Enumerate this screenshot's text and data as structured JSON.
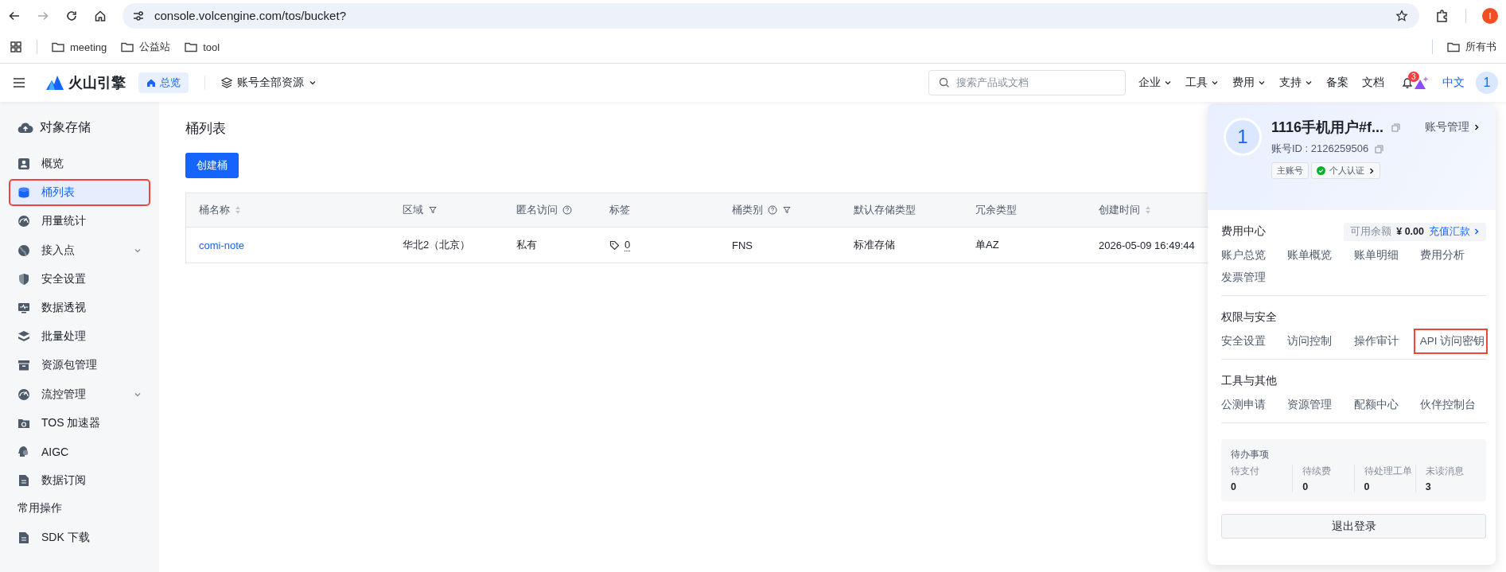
{
  "browser": {
    "url": "console.volcengine.com/tos/bucket?",
    "profile_initial": "I",
    "bookmarks": [
      {
        "label": "meeting"
      },
      {
        "label": "公益站"
      },
      {
        "label": "tool"
      }
    ],
    "bookmarks_right": "所有书"
  },
  "header": {
    "logo": "火山引擎",
    "home": "总览",
    "scope": "账号全部资源",
    "search_placeholder": "搜索产品或文档",
    "menus": [
      {
        "label": "企业",
        "has_menu": true
      },
      {
        "label": "工具",
        "has_menu": true
      },
      {
        "label": "费用",
        "has_menu": true
      },
      {
        "label": "支持",
        "has_menu": true
      },
      {
        "label": "备案",
        "has_menu": false
      },
      {
        "label": "文档",
        "has_menu": false
      }
    ],
    "notification_count": "3",
    "language": {
      "label": "中文",
      "selected": true
    },
    "avatar": "1"
  },
  "sidebar": {
    "title": "对象存储",
    "items": [
      {
        "label": "概览",
        "selected": false,
        "has_submenu": false,
        "highlighted": false
      },
      {
        "label": "桶列表",
        "selected": true,
        "has_submenu": false,
        "highlighted": true
      },
      {
        "label": "用量统计",
        "selected": false,
        "has_submenu": false,
        "highlighted": false
      },
      {
        "label": "接入点",
        "selected": false,
        "has_submenu": true,
        "highlighted": false
      },
      {
        "label": "安全设置",
        "selected": false,
        "has_submenu": false,
        "highlighted": false
      },
      {
        "label": "数据透视",
        "selected": false,
        "has_submenu": false,
        "highlighted": false
      },
      {
        "label": "批量处理",
        "selected": false,
        "has_submenu": false,
        "highlighted": false
      },
      {
        "label": "资源包管理",
        "selected": false,
        "has_submenu": false,
        "highlighted": false
      },
      {
        "label": "流控管理",
        "selected": false,
        "has_submenu": true,
        "highlighted": false
      },
      {
        "label": "TOS 加速器",
        "selected": false,
        "has_submenu": false,
        "highlighted": false
      },
      {
        "label": "AIGC",
        "selected": false,
        "has_submenu": false,
        "highlighted": false
      },
      {
        "label": "数据订阅",
        "selected": false,
        "has_submenu": false,
        "highlighted": false
      }
    ],
    "section": "常用操作",
    "ops": [
      {
        "label": "SDK 下载"
      }
    ]
  },
  "page": {
    "title": "桶列表",
    "create_button": "创建桶",
    "table": {
      "columns": [
        {
          "label": "桶名称",
          "kind": "link",
          "sortable": true,
          "help": false,
          "filter": false
        },
        {
          "label": "区域",
          "kind": "text",
          "sortable": false,
          "help": false,
          "filter": true
        },
        {
          "label": "匿名访问",
          "kind": "text",
          "sortable": false,
          "help": true,
          "filter": false
        },
        {
          "label": "标签",
          "kind": "tag",
          "sortable": false,
          "help": false,
          "filter": false
        },
        {
          "label": "桶类别",
          "kind": "text",
          "sortable": false,
          "help": true,
          "filter": true
        },
        {
          "label": "默认存储类型",
          "kind": "text",
          "sortable": false,
          "help": false,
          "filter": false
        },
        {
          "label": "冗余类型",
          "kind": "text",
          "sortable": false,
          "help": false,
          "filter": false
        },
        {
          "label": "创建时间",
          "kind": "text",
          "sortable": true,
          "help": false,
          "filter": false
        }
      ],
      "rows": [
        [
          "comi-note",
          "华北2（北京）",
          "私有",
          "0",
          "FNS",
          "标准存储",
          "单AZ",
          "2026-05-09 16:49:44"
        ]
      ]
    }
  },
  "panel": {
    "avatar": "1",
    "name": "1116手机用户#f...",
    "account_id": "账号ID : 2126259506",
    "manage": "账号管理",
    "badges": [
      {
        "label": "主账号",
        "kind": "plain"
      },
      {
        "label": "个人认证",
        "kind": "verified"
      }
    ],
    "sections": [
      {
        "title": "费用中心",
        "balance_label": "可用余额",
        "balance": "¥ 0.00",
        "recharge": "充值汇款",
        "links": [
          {
            "label": "账户总览",
            "highlighted": false
          },
          {
            "label": "账单概览",
            "highlighted": false
          },
          {
            "label": "账单明细",
            "highlighted": false
          },
          {
            "label": "费用分析",
            "highlighted": false
          },
          {
            "label": "发票管理",
            "highlighted": false
          }
        ]
      },
      {
        "title": "权限与安全",
        "links": [
          {
            "label": "安全设置",
            "highlighted": false
          },
          {
            "label": "访问控制",
            "highlighted": false
          },
          {
            "label": "操作审计",
            "highlighted": false
          },
          {
            "label": "API 访问密钥",
            "highlighted": true
          }
        ]
      },
      {
        "title": "工具与其他",
        "links": [
          {
            "label": "公测申请",
            "highlighted": false
          },
          {
            "label": "资源管理",
            "highlighted": false
          },
          {
            "label": "配额中心",
            "highlighted": false
          },
          {
            "label": "伙伴控制台",
            "highlighted": false
          }
        ]
      }
    ],
    "todo": {
      "title": "待办事项",
      "items": [
        {
          "label": "待支付",
          "value": "0"
        },
        {
          "label": "待续费",
          "value": "0"
        },
        {
          "label": "待处理工单",
          "value": "0"
        },
        {
          "label": "未读消息",
          "value": "3"
        }
      ]
    },
    "logout": "退出登录"
  }
}
